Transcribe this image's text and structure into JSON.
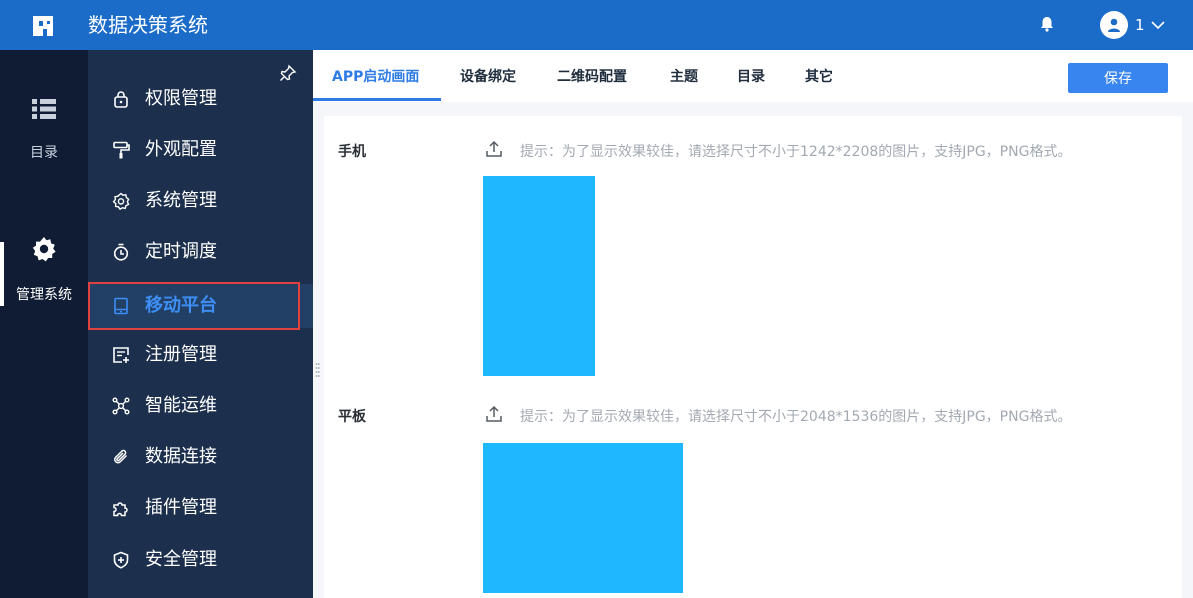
{
  "app": {
    "title": "数据决策系统",
    "user_name": "1"
  },
  "rail": {
    "items": [
      {
        "label": "目录",
        "icon": "list-icon"
      },
      {
        "label": "管理系统",
        "icon": "gear-icon"
      }
    ]
  },
  "sidebar": {
    "items": [
      {
        "label": "权限管理",
        "icon": "lock-icon"
      },
      {
        "label": "外观配置",
        "icon": "paint-roller-icon"
      },
      {
        "label": "系统管理",
        "icon": "settings-icon"
      },
      {
        "label": "定时调度",
        "icon": "stopwatch-icon"
      },
      {
        "label": "移动平台",
        "icon": "tablet-icon"
      },
      {
        "label": "注册管理",
        "icon": "register-icon"
      },
      {
        "label": "智能运维",
        "icon": "network-icon"
      },
      {
        "label": "数据连接",
        "icon": "paperclip-icon"
      },
      {
        "label": "插件管理",
        "icon": "puzzle-icon"
      },
      {
        "label": "安全管理",
        "icon": "shield-icon"
      }
    ]
  },
  "tabs": [
    "APP启动画面",
    "设备绑定",
    "二维码配置",
    "主题",
    "目录",
    "其它"
  ],
  "toolbar": {
    "save_label": "保存"
  },
  "content": {
    "phone": {
      "label": "手机",
      "hint": "提示：为了显示效果较佳，请选择尺寸不小于1242*2208的图片，支持JPG，PNG格式。"
    },
    "tablet": {
      "label": "平板",
      "hint": "提示：为了显示效果较佳，请选择尺寸不小于2048*1536的图片，支持JPG，PNG格式。"
    }
  },
  "colors": {
    "topbar": "#1b6bc9",
    "rail": "#0f1c33",
    "sidebar": "#1c2f4d",
    "accent": "#2d7be5",
    "preview": "#1fb7ff",
    "highlight": "#e0433f"
  }
}
